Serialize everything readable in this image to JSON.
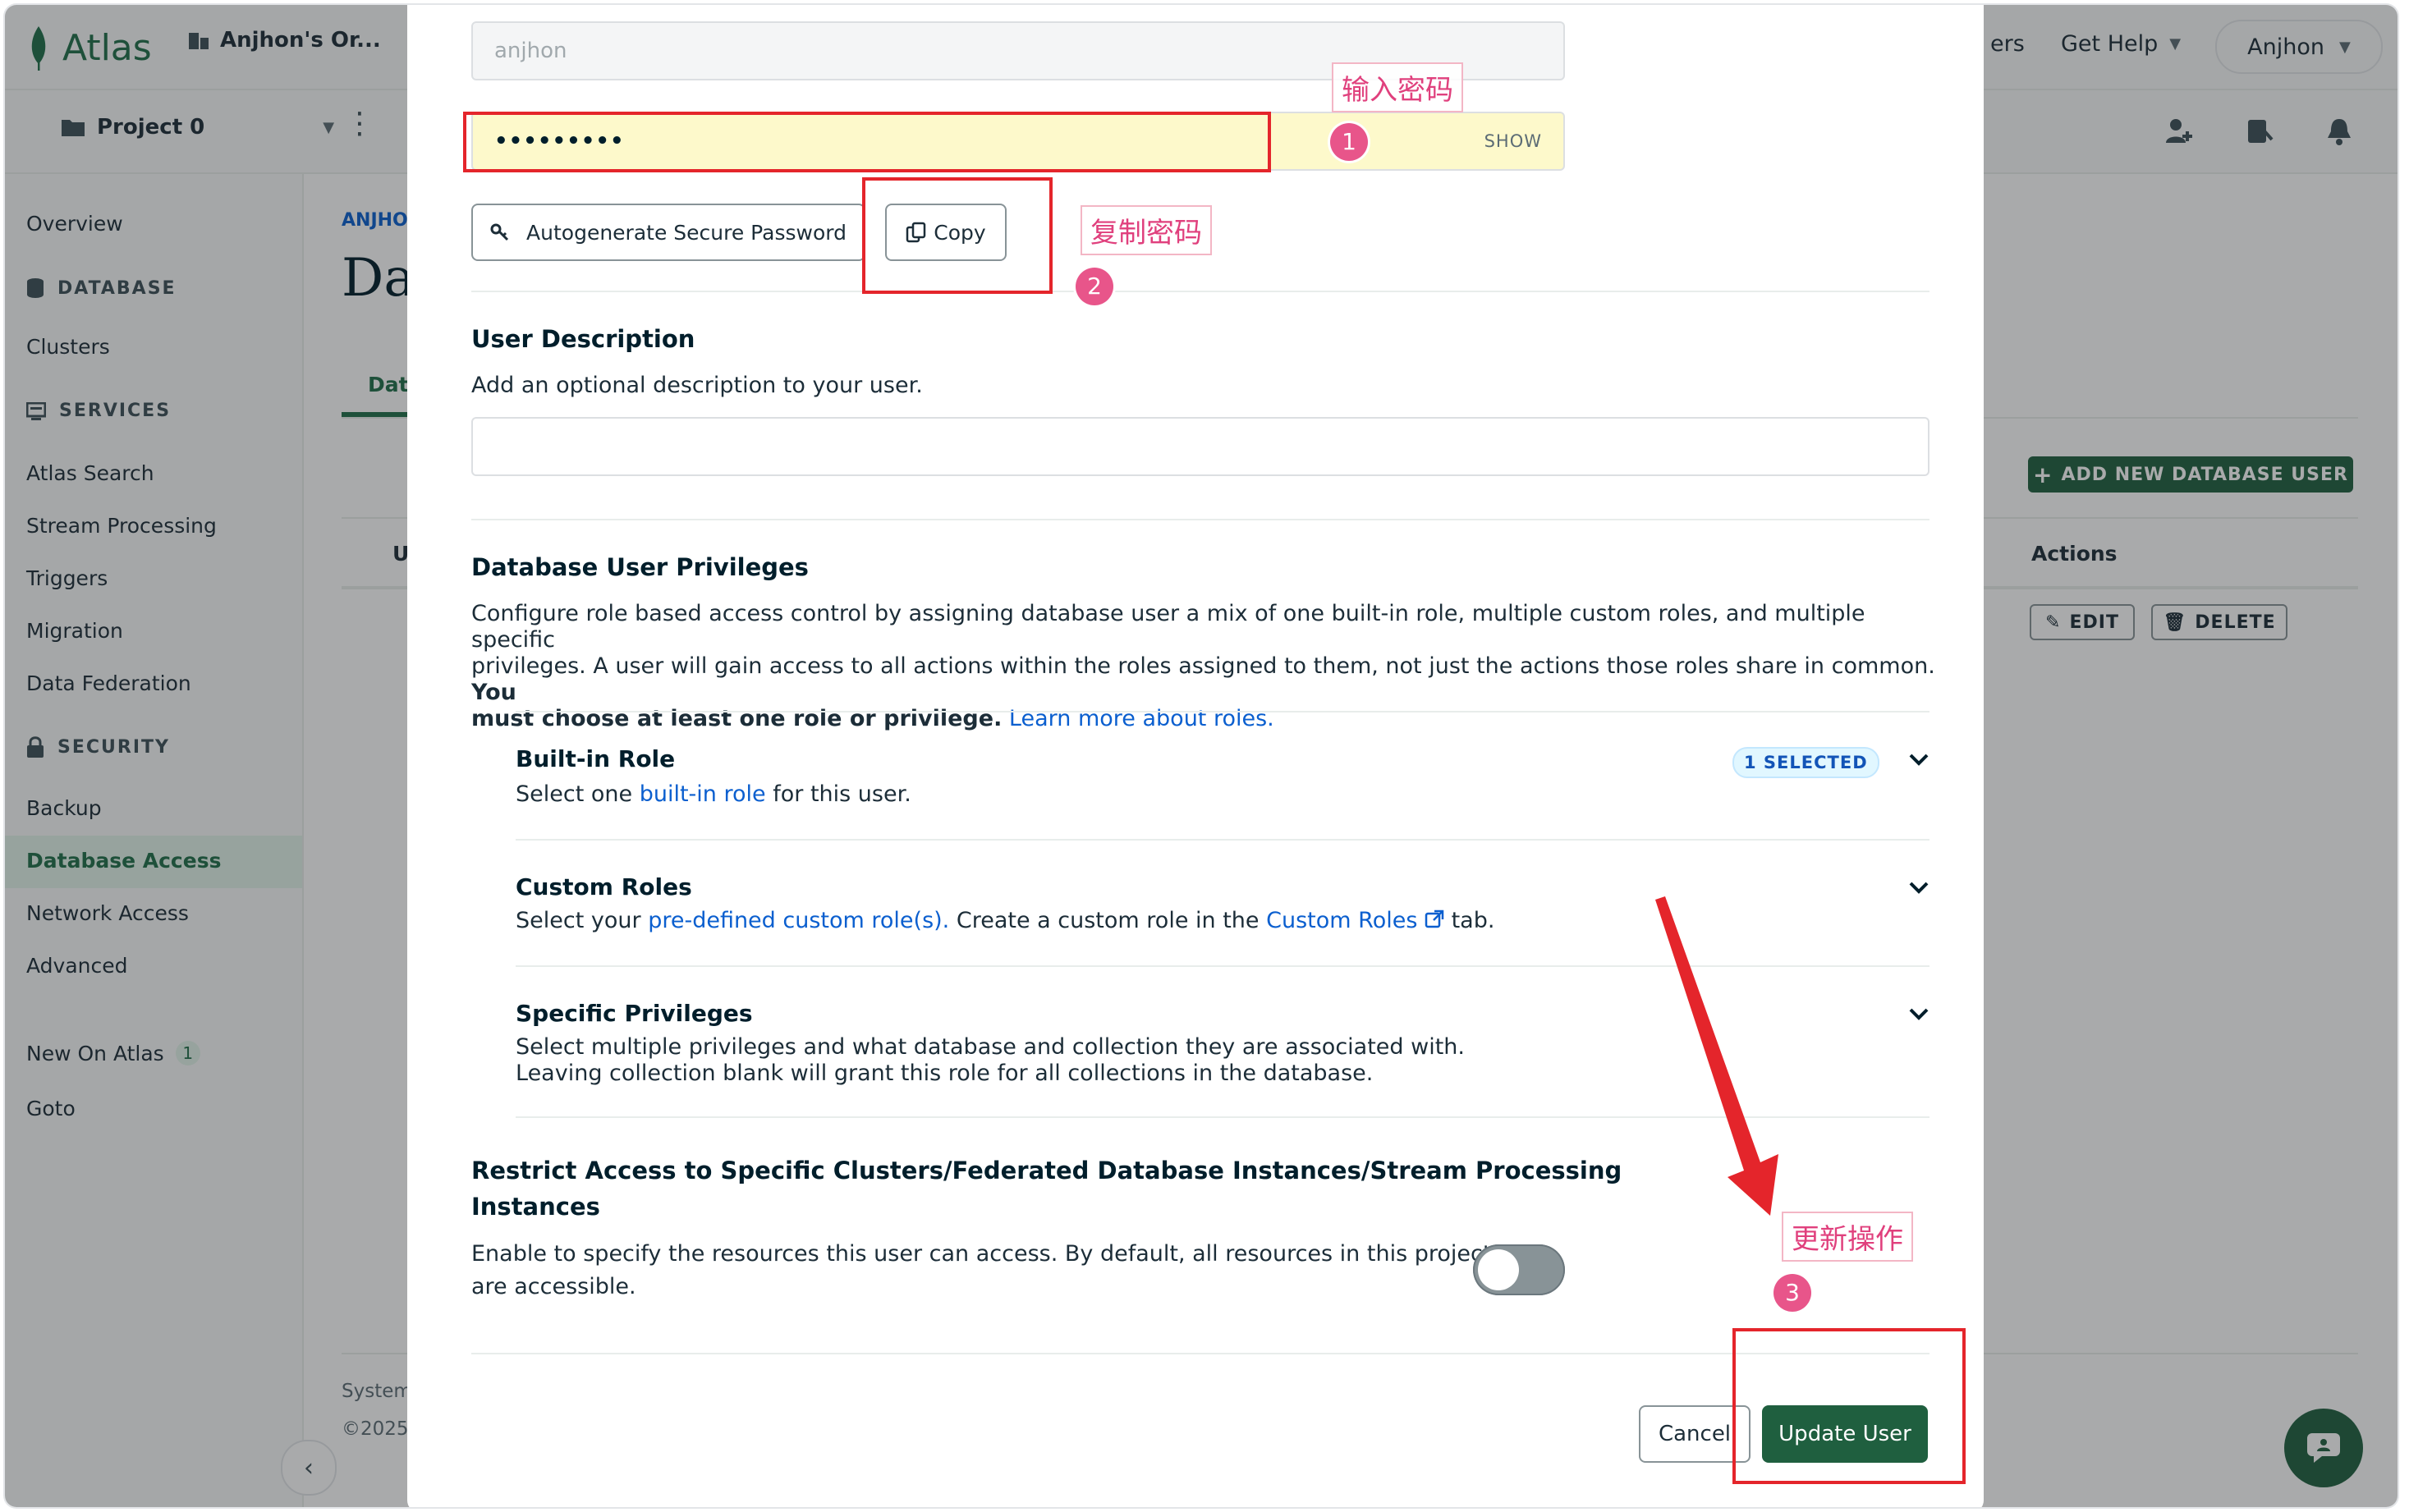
{
  "app": {
    "logo_text": "Atlas",
    "org_name": "Anjhon's Or...",
    "top_right": {
      "partial_label": "ers",
      "help_label": "Get Help",
      "user_label": "Anjhon"
    },
    "project_name": "Project 0"
  },
  "sidebar": {
    "overview": "Overview",
    "database_section": "DATABASE",
    "clusters": "Clusters",
    "services_section": "SERVICES",
    "atlas_search": "Atlas Search",
    "stream_processing": "Stream Processing",
    "triggers": "Triggers",
    "migration": "Migration",
    "data_federation": "Data Federation",
    "security_section": "SECURITY",
    "backup": "Backup",
    "database_access": "Database Access",
    "network_access": "Network Access",
    "advanced": "Advanced",
    "new_on_atlas": "New On Atlas",
    "new_on_atlas_count": "1",
    "goto": "Goto"
  },
  "background_page": {
    "breadcrumb_partial": "ANJHO",
    "title_partial": "Da",
    "tab_partial": "Dat",
    "col_partial": "U",
    "add_user_button": "ADD NEW DATABASE USER",
    "actions_header": "Actions",
    "edit_button": "EDIT",
    "delete_button": "DELETE",
    "footer_partial_1": "System",
    "footer_partial_2": "©2025"
  },
  "modal": {
    "username_value": "anjhon",
    "password_value": "•••••••••",
    "show_label": "SHOW",
    "autogenerate_button": "Autogenerate Secure Password",
    "copy_button": "Copy",
    "description_title": "User Description",
    "description_help": "Add an optional description to your user.",
    "description_value": "",
    "privileges_title": "Database User Privileges",
    "privileges_text_1": "Configure role based access control by assigning database user a mix of one built-in role, multiple custom roles, and multiple specific",
    "privileges_text_2": "privileges. A user will gain access to all actions within the roles assigned to them, not just the actions those roles share in common.",
    "privileges_bold_1": "You",
    "privileges_bold_2": "must choose at least one role or privilege.",
    "privileges_link": "Learn more about roles.",
    "builtin_title": "Built-in Role",
    "builtin_badge": "1 SELECTED",
    "builtin_text_pre": "Select one",
    "builtin_link": "built-in role",
    "builtin_text_post": "for this user.",
    "custom_title": "Custom Roles",
    "custom_text_pre": "Select your",
    "custom_link_1": "pre-defined custom role(s).",
    "custom_text_mid": "Create a custom role in the",
    "custom_link_2": "Custom Roles",
    "custom_text_post": "tab.",
    "specific_title": "Specific Privileges",
    "specific_text_1": "Select multiple privileges and what database and collection they are associated with.",
    "specific_text_2": "Leaving collection blank will grant this role for all collections in the database.",
    "restrict_title_1": "Restrict Access to Specific Clusters/Federated Database Instances/Stream Processing",
    "restrict_title_2": "Instances",
    "restrict_text_1": "Enable to specify the resources this user can access. By default, all resources in this project",
    "restrict_text_2": "are accessible.",
    "restrict_toggle_on": false,
    "cancel_button": "Cancel",
    "update_button": "Update User"
  },
  "annotations": {
    "label_1": "输入密码",
    "label_2": "复制密码",
    "label_3": "更新操作",
    "num_1": "1",
    "num_2": "2",
    "num_3": "3",
    "color": "#e4252b"
  },
  "colors": {
    "brand_green": "#1f5f3f",
    "link_blue": "#0b5fcf",
    "annotation_pink": "#e0407d"
  }
}
